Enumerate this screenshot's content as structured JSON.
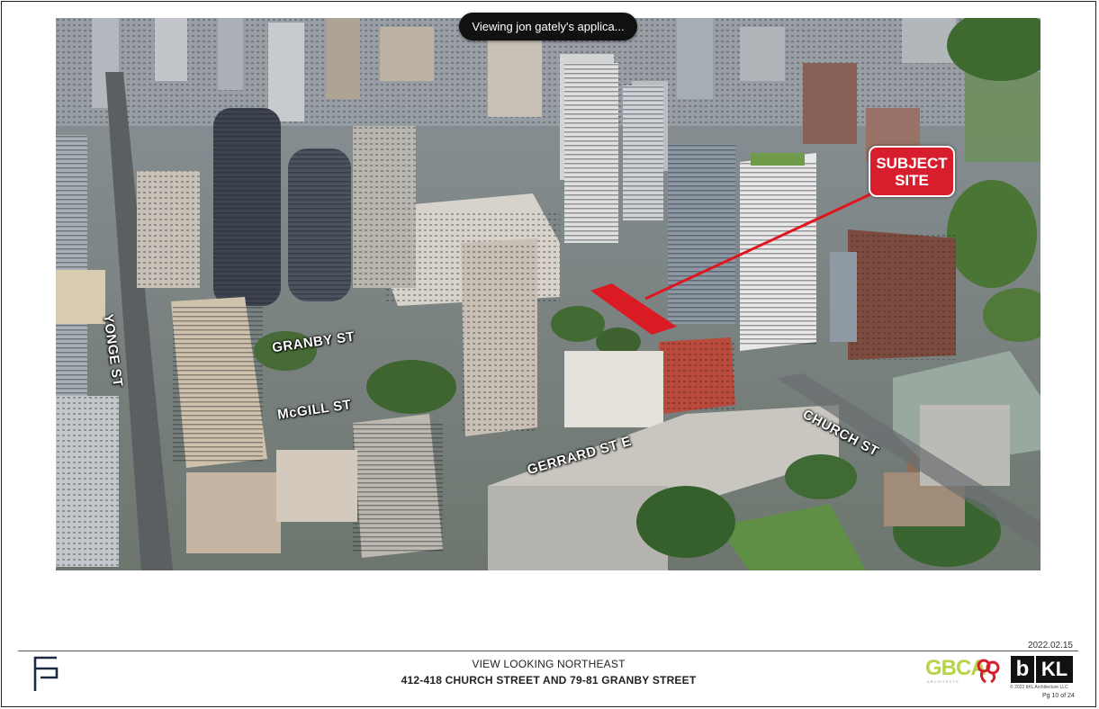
{
  "share_banner": {
    "text": "Viewing jon gately's applica..."
  },
  "aerial": {
    "subject_site": {
      "line1": "SUBJECT",
      "line2": "SITE"
    },
    "streets": {
      "yonge": "YONGE ST",
      "granby": "GRANBY ST",
      "mcgill": "McGILL ST",
      "gerrard": "GERRARD ST E",
      "church": "CHURCH ST"
    },
    "colors": {
      "marker": "#d81e2c",
      "label_text": "#ffffff"
    }
  },
  "footer": {
    "date": "2022.02.15",
    "title": "VIEW LOOKING NORTHEAST",
    "address": "412-418 CHURCH STREET AND 79-81 GRANBY STREET",
    "logos": {
      "gbca": "GBCA",
      "gbca_sub": "ARCHITECTS",
      "bkl_b": "b",
      "bkl_kl": "KL"
    },
    "copyright": "© 2022 bKL Architecture LLC",
    "page": "Pg 10 of 24"
  }
}
